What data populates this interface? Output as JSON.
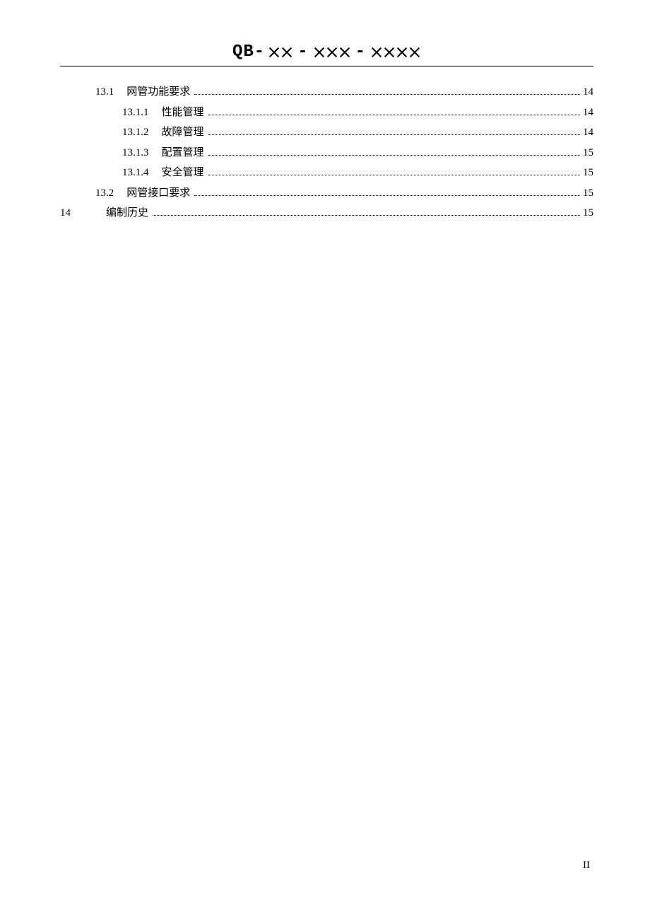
{
  "header": {
    "prefix": "QB-",
    "dash": "-"
  },
  "toc": [
    {
      "indent": 1,
      "num": "13.1",
      "title": "网管功能要求",
      "page": "14",
      "wide": false
    },
    {
      "indent": 2,
      "num": "13.1.1",
      "title": "性能管理",
      "page": "14",
      "wide": false
    },
    {
      "indent": 2,
      "num": "13.1.2",
      "title": "故障管理",
      "page": "14",
      "wide": false
    },
    {
      "indent": 2,
      "num": "13.1.3",
      "title": "配置管理",
      "page": "15",
      "wide": false
    },
    {
      "indent": 2,
      "num": "13.1.4",
      "title": "安全管理",
      "page": "15",
      "wide": false
    },
    {
      "indent": 1,
      "num": "13.2",
      "title": "网管接口要求",
      "page": "15",
      "wide": false
    },
    {
      "indent": 0,
      "num": "14",
      "title": "编制历史",
      "page": "15",
      "wide": true
    }
  ],
  "pageNumber": "II"
}
